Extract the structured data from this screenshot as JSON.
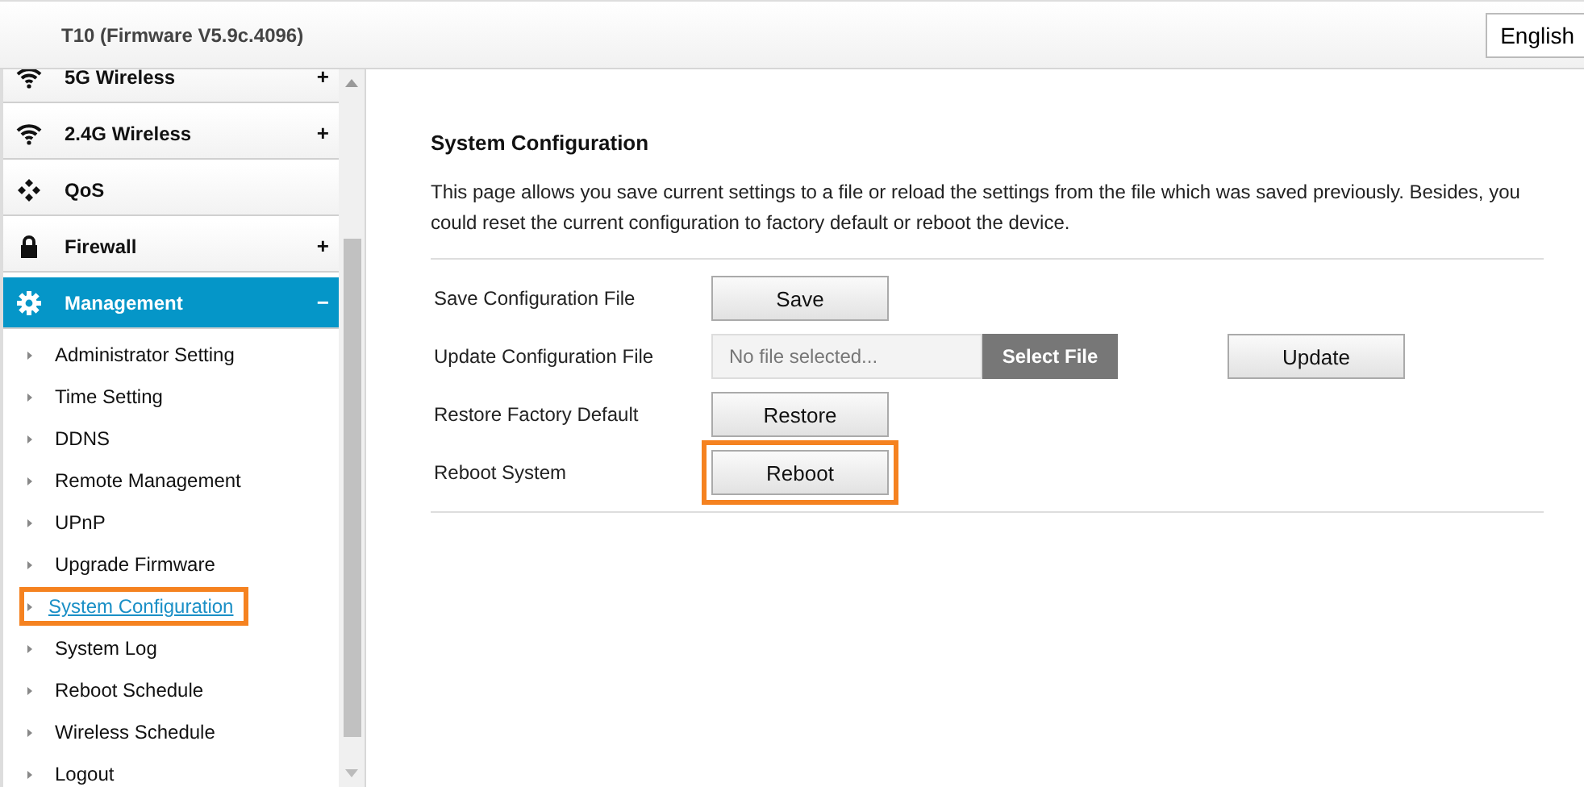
{
  "header": {
    "title": "T10 (Firmware V5.9c.4096)",
    "language": "English"
  },
  "sidebar": {
    "menus": [
      {
        "label": "5G Wireless",
        "toggle": "+",
        "selected": false
      },
      {
        "label": "2.4G Wireless",
        "toggle": "+",
        "selected": false
      },
      {
        "label": "QoS",
        "selected": false
      },
      {
        "label": "Firewall",
        "toggle": "+",
        "selected": false
      },
      {
        "label": "Management",
        "toggle": "−",
        "selected": true,
        "children": [
          {
            "label": "Administrator Setting",
            "selected": false,
            "highlighted": false
          },
          {
            "label": "Time Setting",
            "selected": false,
            "highlighted": false
          },
          {
            "label": "DDNS",
            "selected": false,
            "highlighted": false
          },
          {
            "label": "Remote Management",
            "selected": false,
            "highlighted": false
          },
          {
            "label": "UPnP",
            "selected": false,
            "highlighted": false
          },
          {
            "label": "Upgrade Firmware",
            "selected": false,
            "highlighted": false
          },
          {
            "label": "System Configuration",
            "selected": true,
            "highlighted": true
          },
          {
            "label": "System Log",
            "selected": false,
            "highlighted": false
          },
          {
            "label": "Reboot Schedule",
            "selected": false,
            "highlighted": false
          },
          {
            "label": "Wireless Schedule",
            "selected": false,
            "highlighted": false
          },
          {
            "label": "Logout",
            "selected": false,
            "highlighted": false
          }
        ]
      }
    ]
  },
  "content": {
    "title": "System Configuration",
    "description": "This page allows you save current settings to a file or reload the settings from the file which was saved previously. Besides, you could reset the current configuration to factory default or reboot the device.",
    "rows": [
      {
        "kind": "button",
        "label": "Save Configuration File",
        "button": "Save",
        "highlighted": false
      },
      {
        "kind": "file",
        "label": "Update Configuration File",
        "placeholder": "No file selected...",
        "select": "Select File",
        "button": "Update",
        "highlighted": false
      },
      {
        "kind": "button",
        "label": "Restore Factory Default",
        "button": "Restore",
        "highlighted": false
      },
      {
        "kind": "button",
        "label": "Reboot System",
        "button": "Reboot",
        "highlighted": true
      }
    ]
  }
}
